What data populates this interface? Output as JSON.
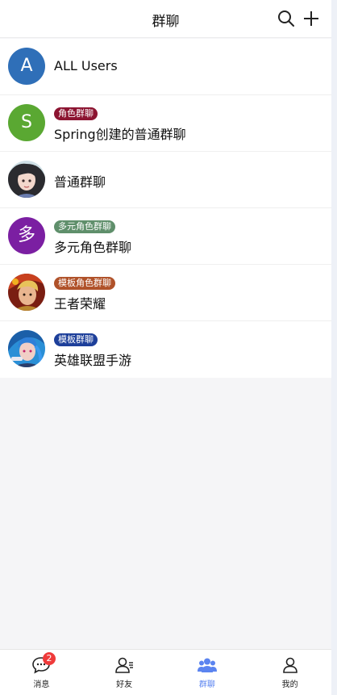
{
  "header": {
    "title": "群聊",
    "search_icon": "search-icon",
    "add_icon": "plus-icon"
  },
  "groups": [
    {
      "avatar_letter": "A",
      "avatar_color": "#2f6fb8",
      "name": "ALL Users"
    },
    {
      "avatar_letter": "S",
      "avatar_color": "#5aa832",
      "badge": "角色群聊",
      "badge_color": "#8c1431",
      "name": "Spring创建的普通群聊"
    },
    {
      "avatar_icon": "anime-girl-avatar",
      "name": "普通群聊"
    },
    {
      "avatar_letter": "多",
      "avatar_color": "#7b1fa2",
      "badge": "多元角色群聊",
      "badge_color": "#5f8f6b",
      "name": "多元角色群聊"
    },
    {
      "avatar_icon": "king-glory-hero-avatar",
      "badge": "模板角色群聊",
      "badge_color": "#b0522a",
      "name": "王者荣耀"
    },
    {
      "avatar_icon": "lol-jinx-avatar",
      "badge": "模板群聊",
      "badge_color": "#1d3f9a",
      "name": "英雄联盟手游"
    }
  ],
  "tabbar": [
    {
      "label": "消息",
      "icon": "message-icon",
      "badge": "2",
      "active": false
    },
    {
      "label": "好友",
      "icon": "friends-icon",
      "active": false
    },
    {
      "label": "群聊",
      "icon": "group-icon",
      "active": true
    },
    {
      "label": "我的",
      "icon": "profile-icon",
      "active": false
    }
  ],
  "colors": {
    "accent": "#5b84f0",
    "unread": "#ef3a3a"
  }
}
